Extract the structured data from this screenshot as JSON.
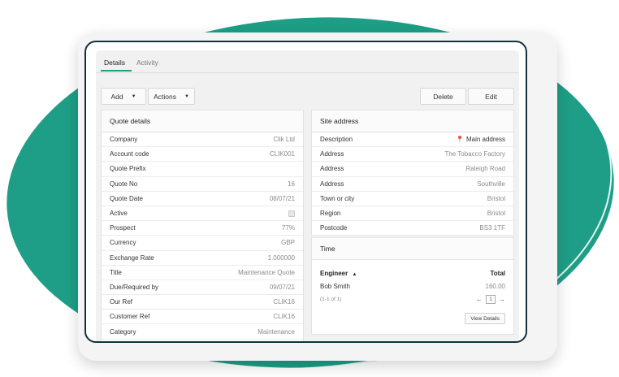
{
  "tabs": [
    {
      "label": "Details"
    },
    {
      "label": "Activity"
    }
  ],
  "toolbar": {
    "add_label": "Add",
    "actions_label": "Actions",
    "delete_label": "Delete",
    "edit_label": "Edit"
  },
  "quote_details": {
    "title": "Quote details",
    "rows": [
      {
        "label": "Company",
        "value": "Clik Ltd"
      },
      {
        "label": "Account code",
        "value": "CLIK001"
      },
      {
        "label": "Quote Prefix",
        "value": ""
      },
      {
        "label": "Quote No",
        "value": "16"
      },
      {
        "label": "Quote Date",
        "value": "08/07/21"
      },
      {
        "label": "Active",
        "value": ""
      },
      {
        "label": "Prospect",
        "value": "77%"
      },
      {
        "label": "Currency",
        "value": "GBP"
      },
      {
        "label": "Exchange Rate",
        "value": "1.000000"
      },
      {
        "label": "Title",
        "value": "Maintenance Quote"
      },
      {
        "label": "Due/Required by",
        "value": "09/07/21"
      },
      {
        "label": "Our Ref",
        "value": "CLIK16"
      },
      {
        "label": "Customer Ref",
        "value": "CLIK16"
      },
      {
        "label": "Category",
        "value": "Maintenance"
      }
    ],
    "active_checked": true
  },
  "site_address": {
    "title": "Site address",
    "rows": [
      {
        "label": "Description",
        "value": "Main address"
      },
      {
        "label": "Address",
        "value": "The Tobacco Factory"
      },
      {
        "label": "Address",
        "value": "Raleigh Road"
      },
      {
        "label": "Address",
        "value": "Southville"
      },
      {
        "label": "Town or city",
        "value": "Bristol"
      },
      {
        "label": "Region",
        "value": "Bristol"
      },
      {
        "label": "Postcode",
        "value": "BS3 1TF"
      }
    ]
  },
  "time": {
    "title": "Time",
    "col_engineer": "Engineer",
    "col_total": "Total",
    "rows": [
      {
        "engineer": "Bob Smith",
        "total": "160.00"
      }
    ],
    "pager_text": "(1-1 of 1)",
    "page": "1",
    "view_details_label": "View Details"
  },
  "colors": {
    "accent": "#1e9e86",
    "frame": "#13313a",
    "pin": "#c0392b"
  },
  "icons": {
    "sort": "caret-up-icon",
    "pin": "map-pin-icon",
    "prev": "arrow-left-icon",
    "next": "arrow-right-icon",
    "dropdown": "caret-down-icon"
  }
}
